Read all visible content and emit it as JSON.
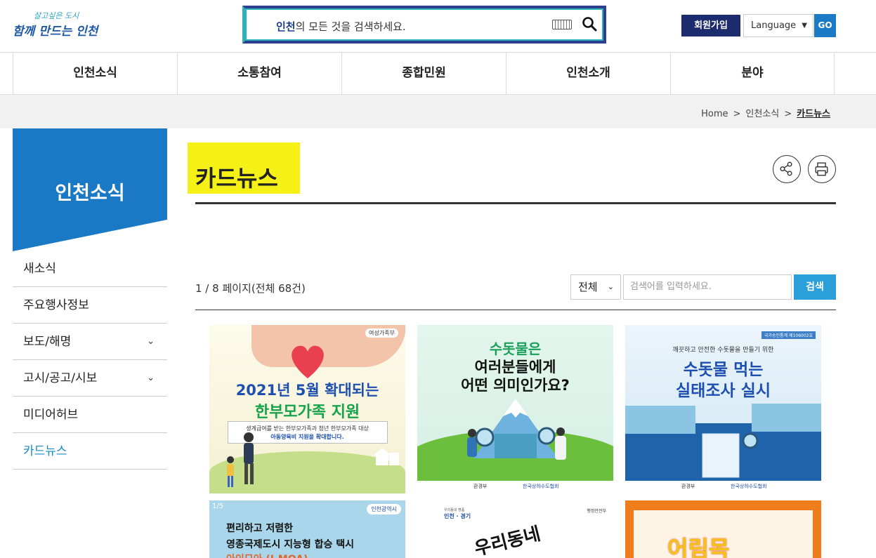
{
  "header": {
    "logo_line1": "살고싶은 도시",
    "logo_line2": "함께 만드는 인천",
    "search_highlight": "인천",
    "search_placeholder": "의 모든 것을 검색하세요.",
    "join_label": "회원가입",
    "language_label": "Language",
    "go_label": "GO"
  },
  "nav": {
    "items": [
      "인천소식",
      "소통참여",
      "종합민원",
      "인천소개",
      "분야"
    ]
  },
  "breadcrumb": {
    "home": "Home",
    "level1": "인천소식",
    "current": "카드뉴스",
    "sep": ">"
  },
  "sidebar": {
    "title": "인천소식",
    "items": [
      {
        "label": "새소식",
        "expandable": false,
        "active": false
      },
      {
        "label": "주요행사정보",
        "expandable": false,
        "active": false
      },
      {
        "label": "보도/해명",
        "expandable": true,
        "active": false
      },
      {
        "label": "고시/공고/시보",
        "expandable": true,
        "active": false
      },
      {
        "label": "미디어허브",
        "expandable": false,
        "active": false
      },
      {
        "label": "카드뉴스",
        "expandable": false,
        "active": true
      }
    ]
  },
  "content": {
    "page_title": "카드뉴스",
    "count_text": "1 / 8 페이지(전체 68건)",
    "filter_value": "전체",
    "keyword_placeholder": "검색어를 입력하세요.",
    "search_button": "검색"
  },
  "cards": [
    {
      "agency": "여성가족부",
      "line1": "2021년 5월 확대되는",
      "line2": "한부모가족 지원",
      "sub1": "생계급여를 받는 한부모가족과 청년 한부모가족 대상",
      "sub2": "아동양육비 지원을 확대합니다."
    },
    {
      "line1": "수돗물은",
      "line2": "여러분들에게",
      "line3": "어떤 의미인가요?",
      "org1": "환경부",
      "org2": "한국상하수도협회"
    },
    {
      "badge": "국가승인통계 제106002호",
      "sub": "깨끗하고 안전한 수돗물을 만들기 위한",
      "line1": "수돗물 먹는",
      "line2": "실태조사 실시",
      "org1": "환경부",
      "org2": "한국상하수도협회"
    },
    {
      "page": "1/5",
      "agency": "인천광역시",
      "line1": "편리하고 저렴한",
      "line2": "영종국제도시 지능형 합승 택시",
      "line3": "아이모아 (I-MOA)"
    },
    {
      "org_small": "우리동네 명품",
      "org_name": "인천 · 경기",
      "agency": "행정안전부",
      "title": "우리동네"
    },
    {
      "title": "어림목"
    }
  ],
  "colors": {
    "brand_navy": "#1c2a6e",
    "brand_blue": "#1b7ac6",
    "accent_teal": "#2bb3b9",
    "sidebar_blue": "#1a79c5",
    "highlight_yellow": "#f5f117"
  }
}
